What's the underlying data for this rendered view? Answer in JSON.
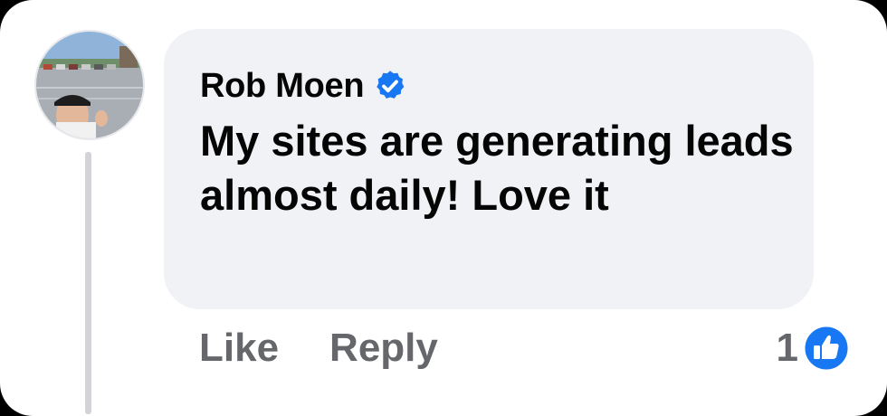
{
  "comment": {
    "author": "Rob Moen",
    "verified": true,
    "text": "My sites are generating leads almost daily! Love it",
    "reaction_count": "1",
    "reaction_icon": "thumbs-up-icon"
  },
  "actions": {
    "like_label": "Like",
    "reply_label": "Reply"
  },
  "colors": {
    "bubble": "#f0f2f5",
    "name": "#050505",
    "action": "#65676b",
    "verified": "#1877f2",
    "thread_line": "#d2d4d8"
  }
}
